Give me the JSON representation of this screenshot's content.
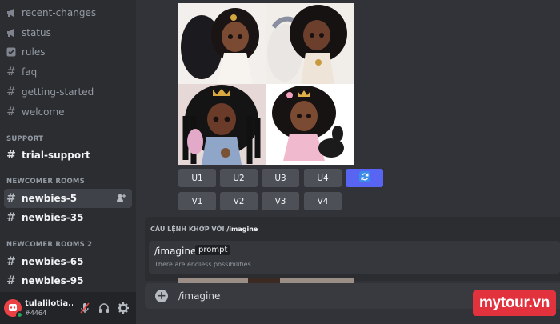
{
  "sidebar": {
    "channels_top": [
      {
        "label": "recent-changes",
        "icon": "megaphone-icon"
      },
      {
        "label": "status",
        "icon": "megaphone-icon"
      },
      {
        "label": "rules",
        "icon": "checkbox-icon"
      },
      {
        "label": "faq",
        "icon": "hash-icon"
      },
      {
        "label": "getting-started",
        "icon": "hash-icon"
      },
      {
        "label": "welcome",
        "icon": "hash-icon"
      }
    ],
    "support_category": "SUPPORT",
    "support_channel": "trial-support",
    "newcomer_category": "NEWCOMER ROOMS",
    "newcomer_channels": [
      "newbies-5",
      "newbies-35"
    ],
    "newcomer2_category": "NEWCOMER ROOMS 2",
    "newcomer2_channels": [
      "newbies-65",
      "newbies-95"
    ]
  },
  "user": {
    "name": "tulalilotia...",
    "tag": "#4464"
  },
  "message": {
    "upscale_buttons": [
      "U1",
      "U2",
      "U3",
      "U4"
    ],
    "variation_buttons": [
      "V1",
      "V2",
      "V3",
      "V4"
    ]
  },
  "autocomplete": {
    "header_prefix": "CÂU LỆNH KHỚP VỚI",
    "header_command": "/imagine",
    "command_name": "/imagine",
    "command_option": "prompt",
    "command_description": "There are endless possibilities..."
  },
  "composer": {
    "value": "/imagine"
  },
  "watermark": "mytour.vn",
  "colors": {
    "background": "#313338",
    "sidebar": "#2b2d31",
    "accent": "#5865f2",
    "watermark": "#e2323d"
  }
}
